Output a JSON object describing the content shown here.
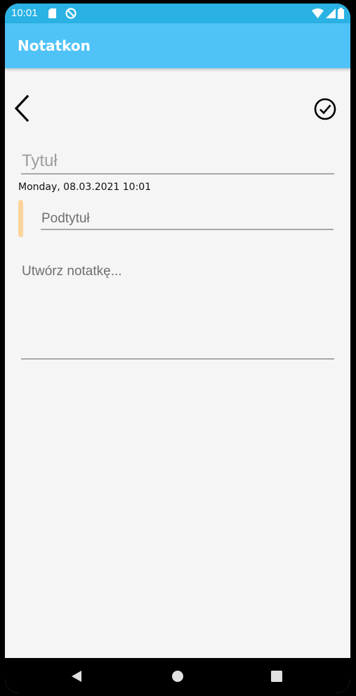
{
  "status_bar": {
    "time": "10:01",
    "icons": [
      "sd-card-icon",
      "do-not-disturb-icon",
      "wifi-icon",
      "signal-icon",
      "battery-icon"
    ]
  },
  "app_bar": {
    "title": "Notatkon"
  },
  "toolbar": {
    "back_icon": "chevron-left-icon",
    "save_icon": "check-circle-icon"
  },
  "note": {
    "title_placeholder": "Tytuł",
    "title_value": "",
    "date_time": "Monday, 08.03.2021 10:01",
    "subtitle_placeholder": "Podtytuł",
    "subtitle_value": "",
    "body_placeholder": "Utwórz notatkę...",
    "body_value": ""
  },
  "nav_bar": {
    "icons": [
      "nav-back-icon",
      "nav-home-icon",
      "nav-recents-icon"
    ]
  },
  "colors": {
    "status_bar": "#2ab2e4",
    "app_bar": "#4fc3f7",
    "background": "#f5f5f5",
    "subtitle_indicator": "#fcd39a"
  }
}
